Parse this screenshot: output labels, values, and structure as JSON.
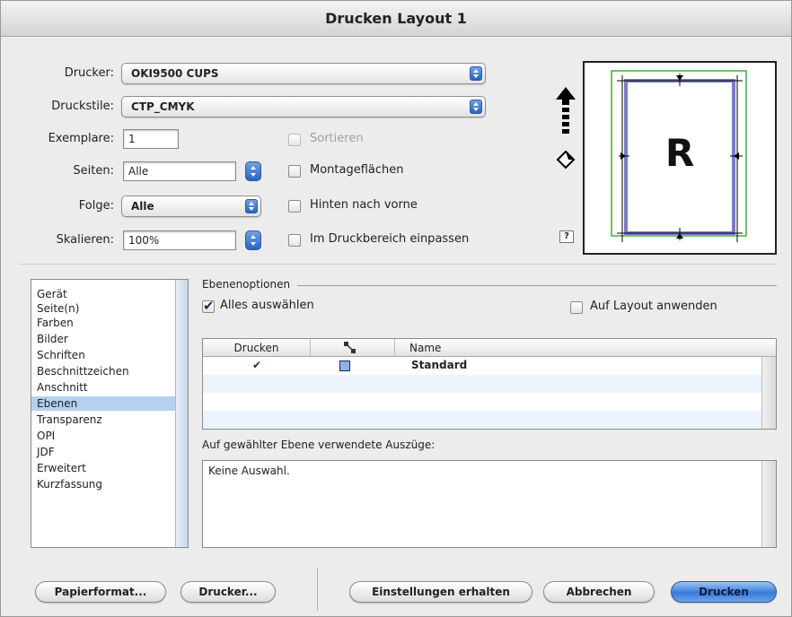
{
  "window": {
    "title": "Drucken Layout 1"
  },
  "form": {
    "drucker_label": "Drucker:",
    "drucker_value": "OKI9500 CUPS",
    "druckstile_label": "Druckstile:",
    "druckstile_value": "CTP_CMYK",
    "exemplare_label": "Exemplare:",
    "exemplare_value": "1",
    "seiten_label": "Seiten:",
    "seiten_value": "Alle",
    "folge_label": "Folge:",
    "folge_value": "Alle",
    "skalieren_label": "Skalieren:",
    "skalieren_value": "100%"
  },
  "options": {
    "sortieren": {
      "label": "Sortieren",
      "checked": false,
      "disabled": true
    },
    "montageflaechen": {
      "label": "Montageflächen",
      "checked": false
    },
    "hinten_nach_vorne": {
      "label": "Hinten nach vorne",
      "checked": false
    },
    "druckbereich": {
      "label": "Im Druckbereich einpassen",
      "checked": false
    }
  },
  "preview": {
    "letter": "R",
    "help": "?"
  },
  "sidebar": {
    "items": [
      {
        "label": "Gerät"
      },
      {
        "label": "Seite(n)"
      },
      {
        "label": "Farben"
      },
      {
        "label": "Bilder"
      },
      {
        "label": "Schriften"
      },
      {
        "label": "Beschnittzeichen"
      },
      {
        "label": "Anschnitt"
      },
      {
        "label": "Ebenen",
        "selected": true
      },
      {
        "label": "Transparenz"
      },
      {
        "label": "OPI"
      },
      {
        "label": "JDF"
      },
      {
        "label": "Erweitert"
      },
      {
        "label": "Kurzfassung"
      }
    ]
  },
  "layers": {
    "section_title": "Ebenenoptionen",
    "select_all": {
      "label": "Alles auswählen",
      "checked": true
    },
    "apply_layout": {
      "label": "Auf Layout anwenden",
      "checked": false
    },
    "columns": {
      "print": "Drucken",
      "name": "Name"
    },
    "rows": [
      {
        "print": true,
        "name": "Standard"
      }
    ],
    "plates_label": "Auf gewählter Ebene verwendete Auszüge:",
    "plates_value": "Keine Auswahl."
  },
  "buttons": {
    "papierformat": "Papierformat...",
    "drucker": "Drucker...",
    "einstellungen": "Einstellungen erhalten",
    "abbrechen": "Abbrechen",
    "drucken": "Drucken"
  },
  "colors": {
    "accent": "#3b7ad8",
    "selection": "#b5d0f0",
    "margin_guide": "#3fae3f",
    "page_border": "#7a7ac8"
  }
}
